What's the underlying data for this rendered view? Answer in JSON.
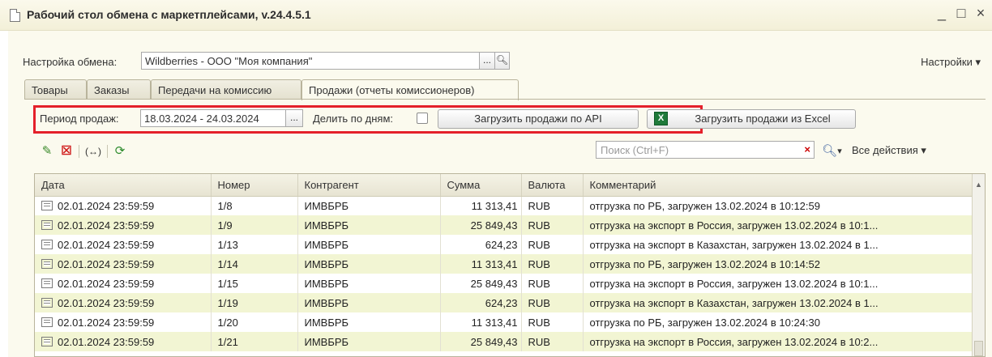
{
  "window": {
    "title": "Рабочий стол обмена с маркетплейсами, v.24.4.5.1",
    "minimize": "_",
    "maximize": "□",
    "close": "×"
  },
  "exchange": {
    "label": "Настройка обмена:",
    "value": "Wildberries - ООО \"Моя компания\"",
    "select_button": "...",
    "settings_menu": "Настройки ▾"
  },
  "tabs": [
    {
      "label": "Товары",
      "active": false
    },
    {
      "label": "Заказы",
      "active": false
    },
    {
      "label": "Передачи на комиссию",
      "active": false
    },
    {
      "label": "Продажи (отчеты комиссионеров)",
      "active": true
    }
  ],
  "sales_toolbar": {
    "period_label": "Период продаж:",
    "period_value": "18.03.2024 - 24.03.2024",
    "period_button": "...",
    "split_label": "Делить по дням:",
    "split_checked": false,
    "load_api": "Загрузить продажи по API",
    "load_excel": "Загрузить продажи из Excel",
    "highlight_color": "#e4202a"
  },
  "list_toolbar": {
    "edit_icon": "pencil-icon",
    "delete_icon": "delete-icon",
    "fields_icon": "field-list-icon",
    "refresh_icon": "refresh-icon",
    "search_placeholder": "Поиск (Ctrl+F)",
    "search_clear": "×",
    "search_menu": "▾",
    "all_actions": "Все действия ▾"
  },
  "table": {
    "columns": [
      "Дата",
      "Номер",
      "Контрагент",
      "Сумма",
      "Валюта",
      "Комментарий"
    ],
    "rows": [
      [
        "02.01.2024 23:59:59",
        "1/8",
        "ИМВБРБ",
        "11 313,41",
        "RUB",
        "отгрузка по РБ, загружен 13.02.2024 в 10:12:59"
      ],
      [
        "02.01.2024 23:59:59",
        "1/9",
        "ИМВБРБ",
        "25 849,43",
        "RUB",
        "отгрузка на экспорт в Россия, загружен 13.02.2024 в 10:1..."
      ],
      [
        "02.01.2024 23:59:59",
        "1/13",
        "ИМВБРБ",
        "624,23",
        "RUB",
        "отгрузка на экспорт в Казахстан, загружен 13.02.2024 в 1..."
      ],
      [
        "02.01.2024 23:59:59",
        "1/14",
        "ИМВБРБ",
        "11 313,41",
        "RUB",
        "отгрузка по РБ, загружен 13.02.2024 в 10:14:52"
      ],
      [
        "02.01.2024 23:59:59",
        "1/15",
        "ИМВБРБ",
        "25 849,43",
        "RUB",
        "отгрузка на экспорт в Россия, загружен 13.02.2024 в 10:1..."
      ],
      [
        "02.01.2024 23:59:59",
        "1/19",
        "ИМВБРБ",
        "624,23",
        "RUB",
        "отгрузка на экспорт в Казахстан, загружен 13.02.2024 в 1..."
      ],
      [
        "02.01.2024 23:59:59",
        "1/20",
        "ИМВБРБ",
        "11 313,41",
        "RUB",
        "отгрузка по РБ, загружен 13.02.2024 в 10:24:30"
      ],
      [
        "02.01.2024 23:59:59",
        "1/21",
        "ИМВБРБ",
        "25 849,43",
        "RUB",
        "отгрузка на экспорт в Россия, загружен 13.02.2024 в 10:2..."
      ]
    ]
  }
}
